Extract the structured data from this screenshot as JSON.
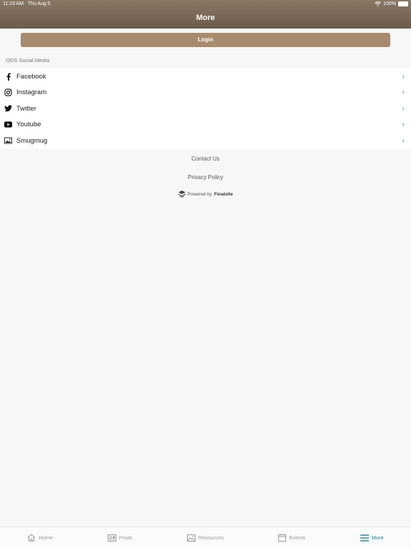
{
  "status_bar": {
    "time": "11:23 AM",
    "date": "Thu Aug 5",
    "battery": "100%"
  },
  "header": {
    "title": "More"
  },
  "login": {
    "label": "Login"
  },
  "social": {
    "section_label": "ODS Social Media",
    "items": [
      {
        "label": "Facebook",
        "icon": "facebook-icon"
      },
      {
        "label": "Instagram",
        "icon": "instagram-icon"
      },
      {
        "label": "Twitter",
        "icon": "twitter-icon"
      },
      {
        "label": "Youtube",
        "icon": "youtube-icon"
      },
      {
        "label": "Smugmug",
        "icon": "image-icon"
      }
    ]
  },
  "footer": {
    "contact": "Contact Us",
    "privacy": "Privacy Policy",
    "powered_prefix": "Powered by",
    "powered_brand": "Finalsite"
  },
  "tabs": [
    {
      "label": "Home",
      "icon": "home-icon"
    },
    {
      "label": "Posts",
      "icon": "posts-icon"
    },
    {
      "label": "Resources",
      "icon": "image-icon"
    },
    {
      "label": "Events",
      "icon": "calendar-icon"
    },
    {
      "label": "More",
      "icon": "menu-icon",
      "active": true
    }
  ],
  "colors": {
    "accent": "#a88b6e",
    "header": "#7a6958",
    "active_tab": "#2a7f8f",
    "chevron": "#2d8bd8"
  }
}
